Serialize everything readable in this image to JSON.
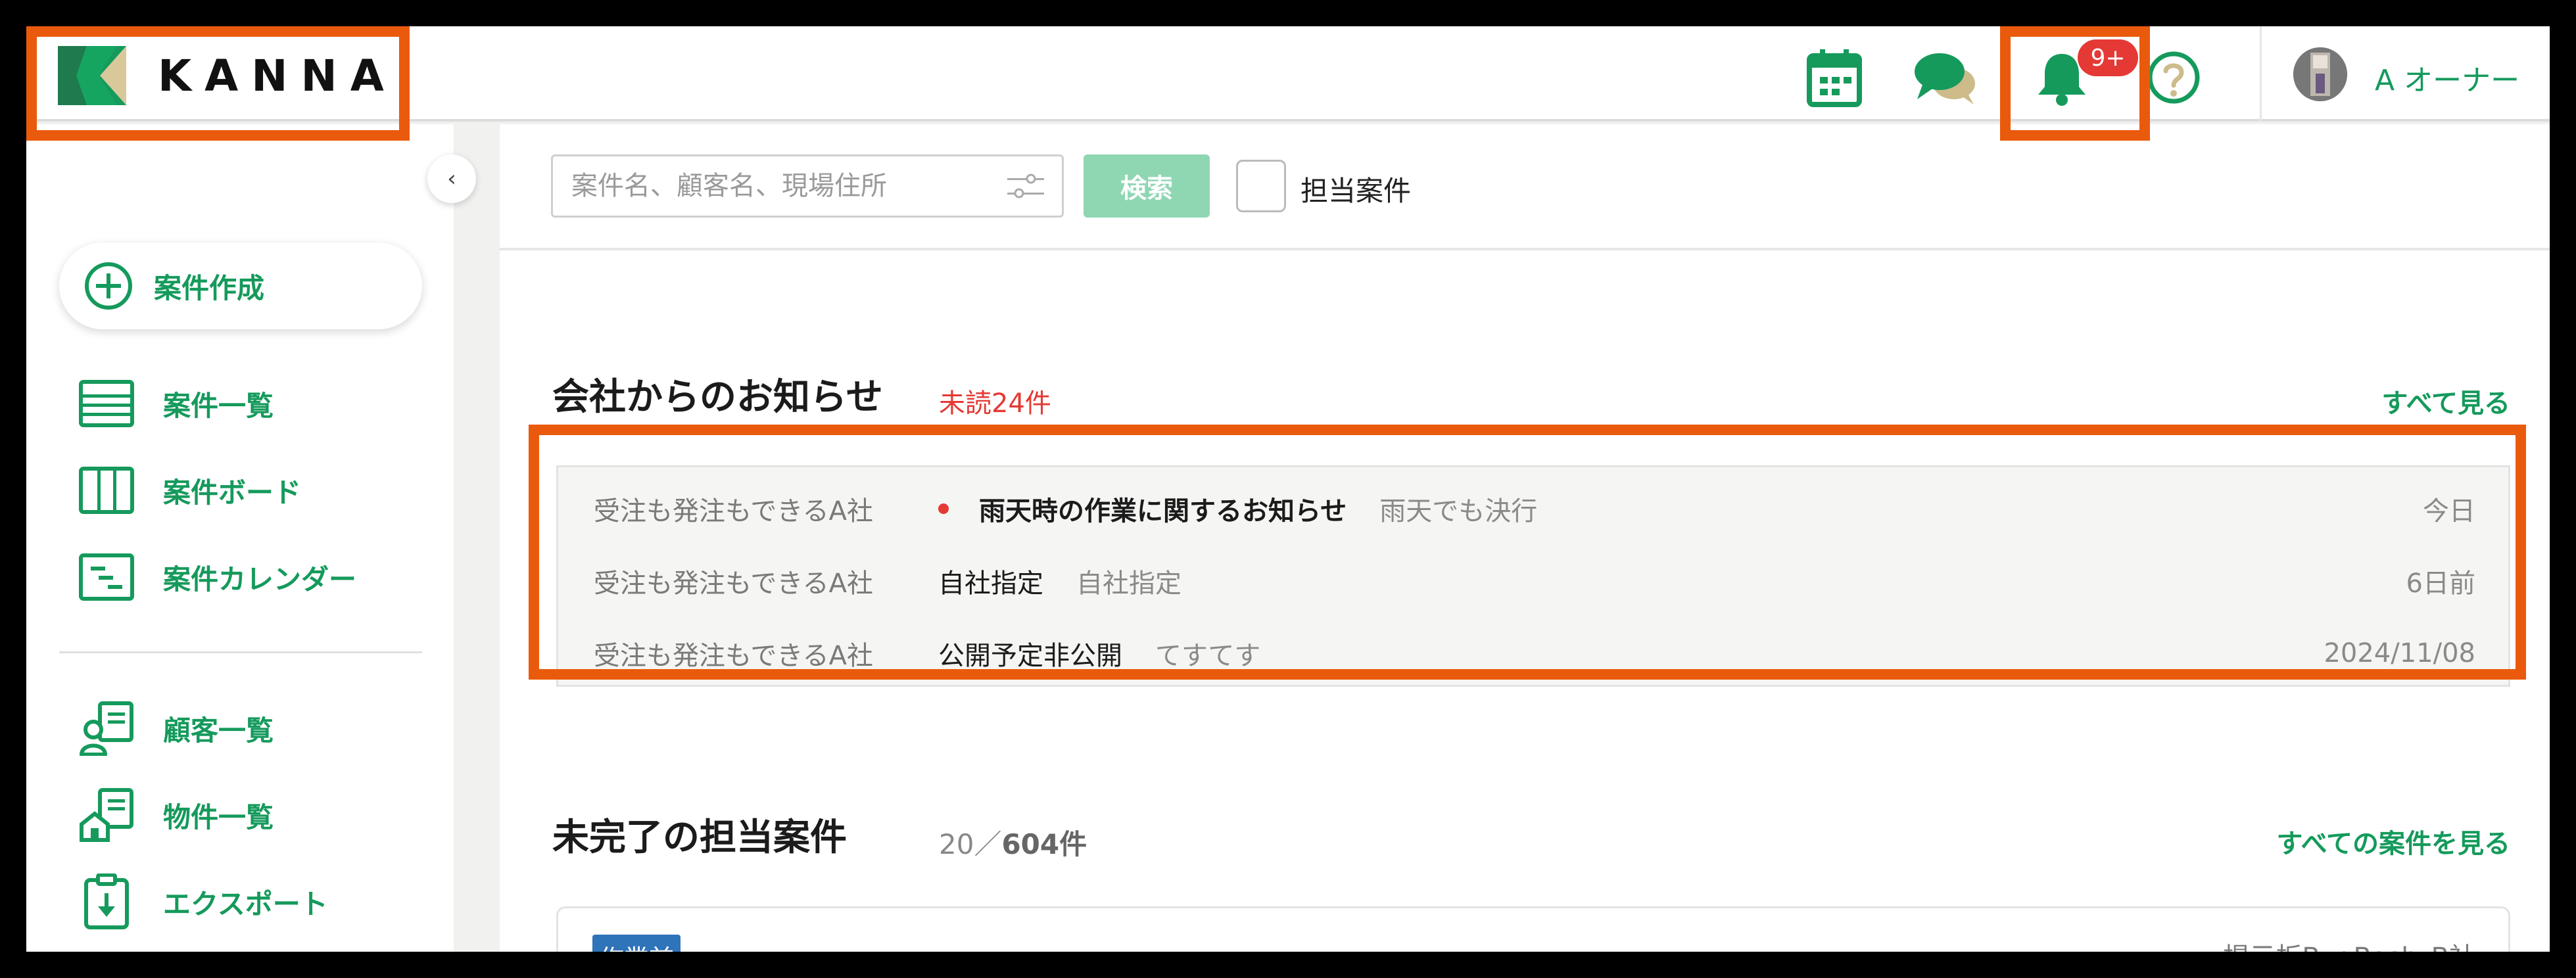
{
  "header": {
    "logo_text": "KANNA",
    "notification_badge": "9+",
    "user_name": "A オーナー"
  },
  "sidebar": {
    "create_label": "案件作成",
    "items": [
      {
        "label": "案件一覧"
      },
      {
        "label": "案件ボード"
      },
      {
        "label": "案件カレンダー"
      },
      {
        "label": "顧客一覧"
      },
      {
        "label": "物件一覧"
      },
      {
        "label": "エクスポート"
      }
    ]
  },
  "search": {
    "placeholder": "案件名、顧客名、現場住所",
    "button_label": "検索",
    "mine_label": "担当案件"
  },
  "notices": {
    "title": "会社からのお知らせ",
    "unread": "未読24件",
    "see_all": "すべて見る",
    "rows": [
      {
        "company": "受注も発注もできるA社",
        "title": "雨天時の作業に関するお知らせ",
        "body": "雨天でも決行",
        "date": "今日"
      },
      {
        "company": "受注も発注もできるA社",
        "title": "自社指定",
        "body": "自社指定",
        "date": "6日前"
      },
      {
        "company": "受注も発注もできるA社",
        "title": "公開予定非公開",
        "body": "てすてす",
        "date": "2024/11/08"
      }
    ]
  },
  "tasks": {
    "title": "未完了の担当案件",
    "count_shown": "20／",
    "count_total": "604件",
    "see_all": "すべての案件を見る",
    "card": {
      "status": "作業前",
      "company": "掲示板BugBash_B社"
    }
  },
  "colors": {
    "brand_green": "#159a5c",
    "highlight": "#ea5a0c",
    "alert_red": "#e53935",
    "status_blue": "#2f73b9"
  }
}
